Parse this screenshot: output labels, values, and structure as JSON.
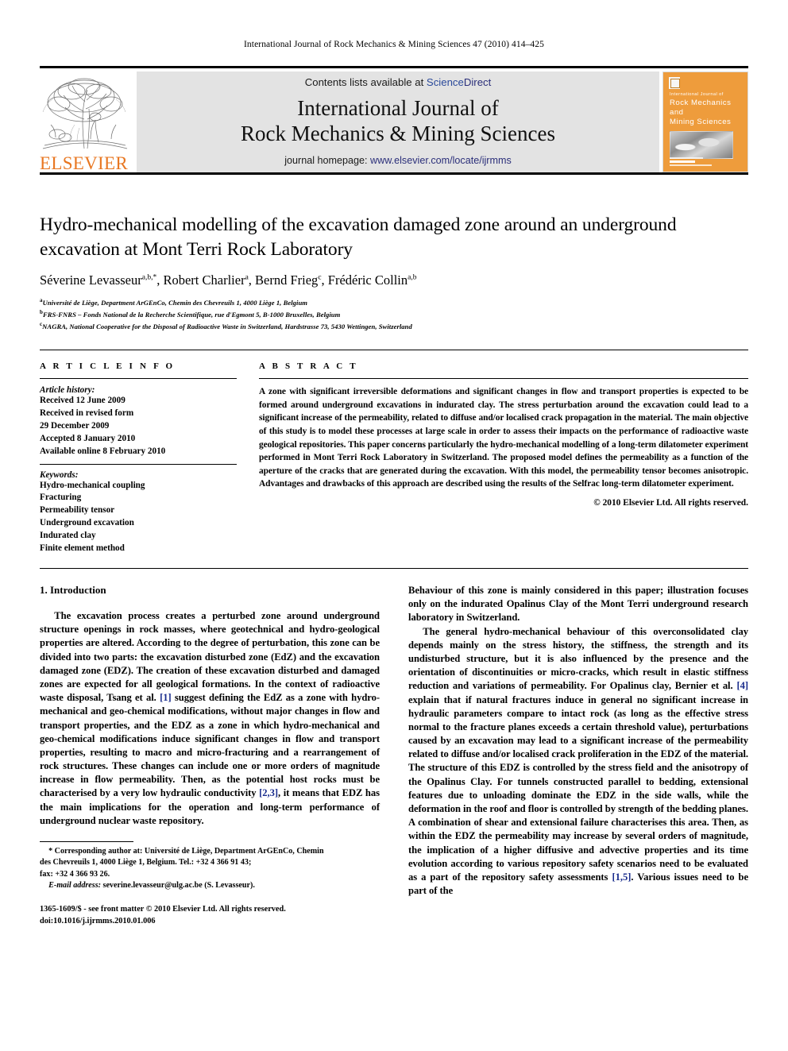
{
  "running_head": "International Journal of Rock Mechanics & Mining Sciences 47 (2010) 414–425",
  "masthead": {
    "publisher_logo_label": "ELSEVIER",
    "contents_prefix": "Contents lists available at ",
    "contents_link_science": "Science",
    "contents_link_direct": "Direct",
    "journal_title_line1": "International Journal of",
    "journal_title_line2": "Rock Mechanics & Mining Sciences",
    "homepage_prefix": "journal homepage: ",
    "homepage_url": "www.elsevier.com/locate/ijrmms",
    "cover": {
      "tiny_line": "International Journal of",
      "line1": "Rock Mechanics",
      "line2": "and",
      "line3": "Mining Sciences"
    }
  },
  "article": {
    "title": "Hydro-mechanical modelling of the excavation damaged zone around an underground excavation at Mont Terri Rock Laboratory",
    "authors_html": "Séverine Levasseur<sup>a,b,*</sup>, Robert Charlier<sup>a</sup>, Bernd Frieg<sup>c</sup>, Frédéric Collin<sup>a,b</sup>",
    "affiliations": [
      {
        "marker": "a",
        "text": "Université de Liège, Department ArGEnCo, Chemin des Chevreuils 1, 4000 Liège 1, Belgium"
      },
      {
        "marker": "b",
        "text": "FRS-FNRS – Fonds National de la Recherche Scientifique, rue d'Egmont 5, B-1000 Bruxelles, Belgium"
      },
      {
        "marker": "c",
        "text": "NAGRA, National Cooperative for the Disposal of Radioactive Waste in Switzerland, Hardstrasse 73, 5430 Wettingen, Switzerland"
      }
    ]
  },
  "article_info": {
    "heading": "A R T I C L E   I N F O",
    "history_label": "Article history:",
    "history_lines": [
      "Received 12 June 2009",
      "Received in revised form",
      "29 December 2009",
      "Accepted 8 January 2010",
      "Available online 8 February 2010"
    ],
    "keywords_label": "Keywords:",
    "keywords": [
      "Hydro-mechanical coupling",
      "Fracturing",
      "Permeability tensor",
      "Underground excavation",
      "Indurated clay",
      "Finite element method"
    ]
  },
  "abstract": {
    "heading": "A B S T R A C T",
    "text": "A zone with significant irreversible deformations and significant changes in flow and transport properties is expected to be formed around underground excavations in indurated clay. The stress perturbation around the excavation could lead to a significant increase of the permeability, related to diffuse and/or localised crack propagation in the material. The main objective of this study is to model these processes at large scale in order to assess their impacts on the performance of radioactive waste geological repositories. This paper concerns particularly the hydro-mechanical modelling of a long-term dilatometer experiment performed in Mont Terri Rock Laboratory in Switzerland. The proposed model defines the permeability as a function of the aperture of the cracks that are generated during the excavation. With this model, the permeability tensor becomes anisotropic. Advantages and drawbacks of this approach are described using the results of the Selfrac long-term dilatometer experiment.",
    "copyright": "© 2010 Elsevier Ltd. All rights reserved."
  },
  "body": {
    "section_number_title": "1. Introduction",
    "left_paragraphs": [
      "The excavation process creates a perturbed zone around underground structure openings in rock masses, where geotechnical and hydro-geological properties are altered. According to the degree of perturbation, this zone can be divided into two parts: the excavation disturbed zone (EdZ) and the excavation damaged zone (EDZ). The creation of these excavation disturbed and damaged zones are expected for all geological formations. In the context of radioactive waste disposal, Tsang et al. [1] suggest defining the EdZ as a zone with hydro-mechanical and geo-chemical modifications, without major changes in flow and transport properties, and the EDZ as a zone in which hydro-mechanical and geo-chemical modifications induce significant changes in flow and transport properties, resulting to macro and micro-fracturing and a rearrangement of rock structures. These changes can include one or more orders of magnitude increase in flow permeability. Then, as the potential host rocks must be characterised by a very low hydraulic conductivity [2,3], it means that EDZ has the main implications for the operation and long-term performance of underground nuclear waste repository."
    ],
    "right_paragraphs": [
      "Behaviour of this zone is mainly considered in this paper; illustration focuses only on the indurated Opalinus Clay of the Mont Terri underground research laboratory in Switzerland.",
      "The general hydro-mechanical behaviour of this overconsolidated clay depends mainly on the stress history, the stiffness, the strength and its undisturbed structure, but it is also influenced by the presence and the orientation of discontinuities or micro-cracks, which result in elastic stiffness reduction and variations of permeability. For Opalinus clay, Bernier et al. [4] explain that if natural fractures induce in general no significant increase in hydraulic parameters compare to intact rock (as long as the effective stress normal to the fracture planes exceeds a certain threshold value), perturbations caused by an excavation may lead to a significant increase of the permeability related to diffuse and/or localised crack proliferation in the EDZ of the material. The structure of this EDZ is controlled by the stress field and the anisotropy of the Opalinus Clay. For tunnels constructed parallel to bedding, extensional features due to unloading dominate the EDZ in the side walls, while the deformation in the roof and floor is controlled by strength of the bedding planes. A combination of shear and extensional failure characterises this area. Then, as within the EDZ the permeability may increase by several orders of magnitude, the implication of a higher diffusive and advective properties and its time evolution according to various repository safety scenarios need to be evaluated as a part of the repository safety assessments [1,5]. Various issues need to be part of the"
    ]
  },
  "footnote": {
    "corresponding_line1": "* Corresponding author at: Université de Liège, Department ArGEnCo, Chemin",
    "corresponding_line2": "des Chevreuils 1, 4000 Liège 1, Belgium. Tel.: +32 4 366 91 43;",
    "corresponding_line3": "fax: +32 4 366 93 26.",
    "email_label": "E-mail address:",
    "email_value": " severine.levasseur@ulg.ac.be (S. Levasseur).",
    "issn_line": "1365-1609/$ - see front matter © 2010 Elsevier Ltd. All rights reserved.",
    "doi_line": "doi:10.1016/j.ijrmms.2010.01.006"
  },
  "colors": {
    "elsevier_orange": "#E87722",
    "link_blue": "#2b2f7a",
    "cover_orange": "#EE9C3C",
    "reference_blue": "#1a2d8d",
    "masthead_grey": "#e3e3e3"
  }
}
